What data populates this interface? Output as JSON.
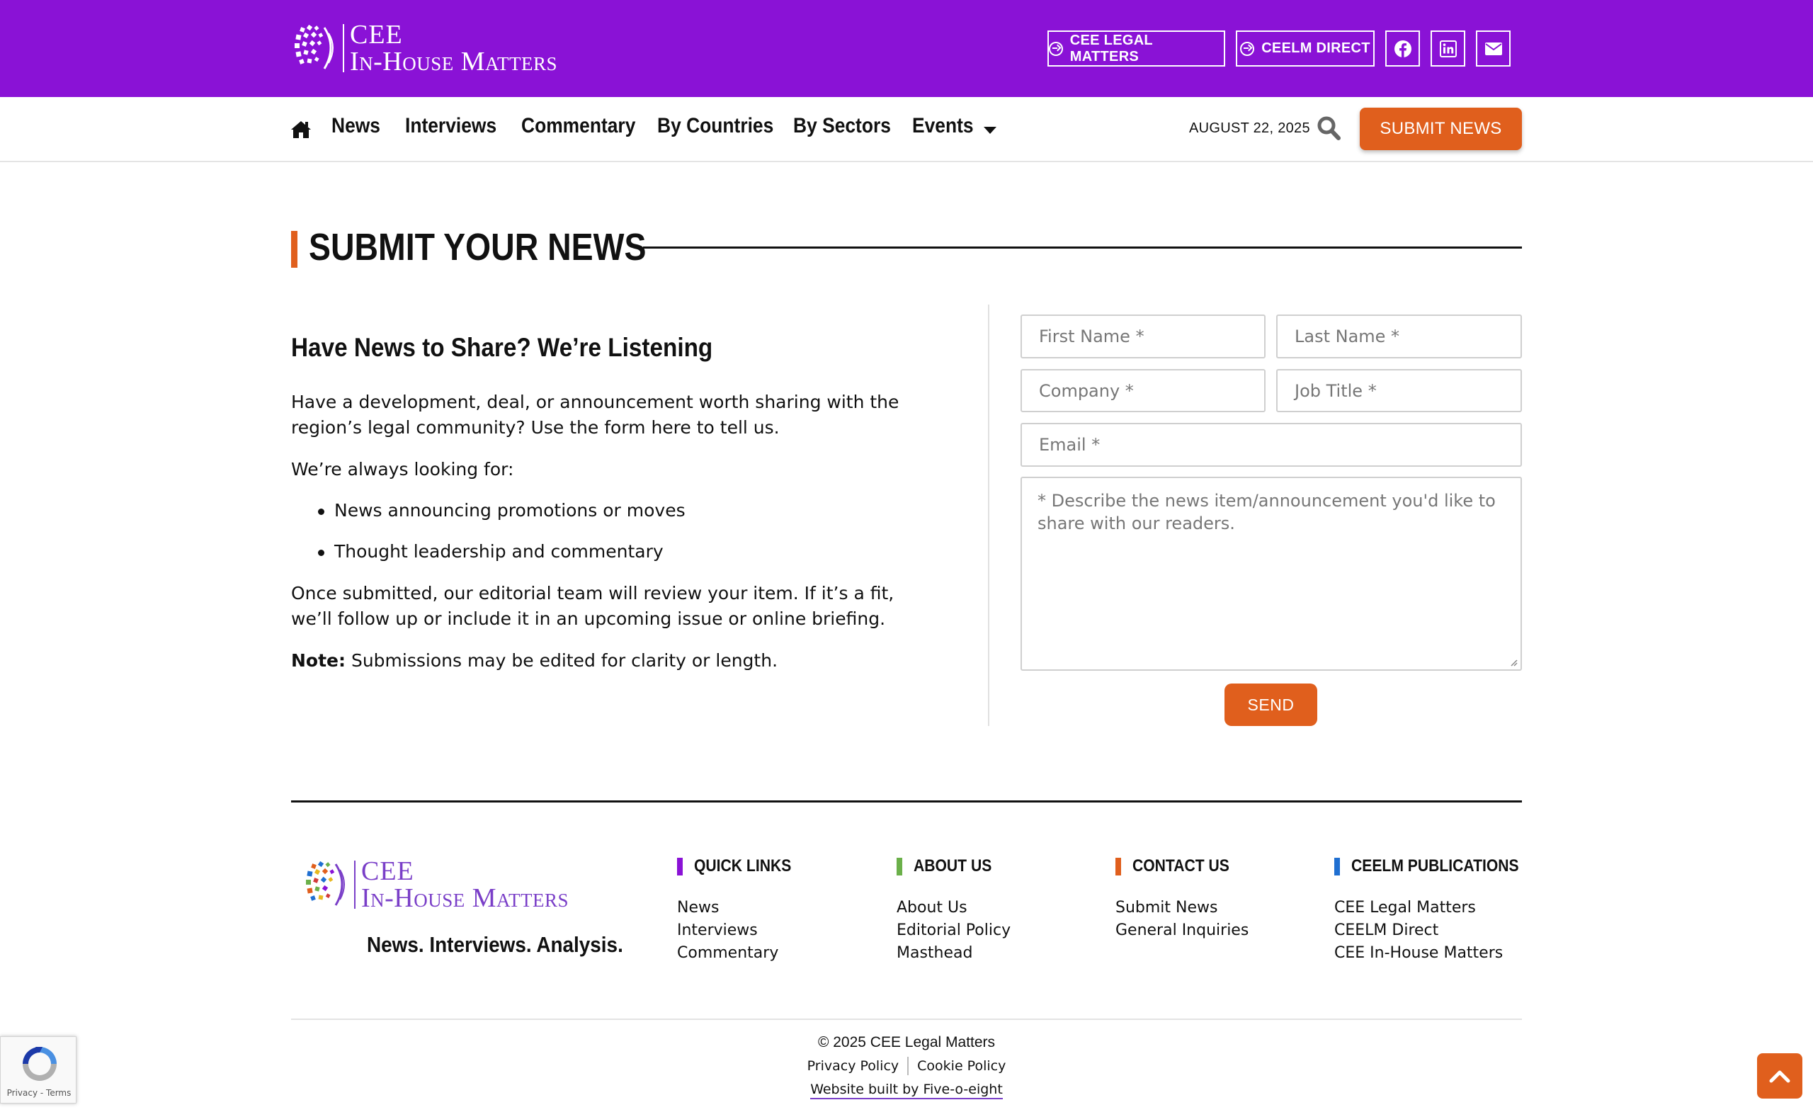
{
  "brand": {
    "line1": "CEE",
    "line2": "In-House Matters",
    "tagline": "News. Interviews. Analysis."
  },
  "topbar": {
    "buttons": [
      {
        "label": "CEE LEGAL MATTERS"
      },
      {
        "label": "CEELM DIRECT"
      }
    ],
    "social": [
      "facebook-icon",
      "linkedin-icon",
      "envelope-icon"
    ]
  },
  "nav": {
    "items": [
      {
        "label": "News"
      },
      {
        "label": "Interviews"
      },
      {
        "label": "Commentary"
      },
      {
        "label": "By Countries"
      },
      {
        "label": "By Sectors"
      },
      {
        "label": "Events"
      }
    ],
    "date": "AUGUST 22, 2025",
    "submit_label": "SUBMIT NEWS"
  },
  "page": {
    "title": "SUBMIT YOUR NEWS"
  },
  "content": {
    "heading": "Have News to Share? We’re Listening",
    "intro": "Have a development, deal, or announcement worth sharing with the region’s legal community? Use the form here to tell us.",
    "looking_for": "We’re always looking for:",
    "bullets": [
      "News announcing promotions or moves",
      "Thought leadership and commentary"
    ],
    "review": "Once submitted, our editorial team will review your item. If it’s a fit, we’ll follow up or include it in an upcoming issue or online briefing.",
    "note_label": "Note:",
    "note_text": " Submissions may be edited for clarity or length."
  },
  "form": {
    "first_name": {
      "placeholder": "First Name *",
      "value": ""
    },
    "last_name": {
      "placeholder": "Last Name *",
      "value": ""
    },
    "company": {
      "placeholder": "Company *",
      "value": ""
    },
    "job_title": {
      "placeholder": "Job Title *",
      "value": ""
    },
    "email": {
      "placeholder": "Email *",
      "value": ""
    },
    "message": {
      "placeholder": "* Describe the news item/announcement you'd like to share with our readers.",
      "value": ""
    },
    "send_label": "SEND"
  },
  "footer": {
    "columns": [
      {
        "title": "QUICK LINKS",
        "color": "#8a12d6",
        "links": [
          "News",
          "Interviews",
          "Commentary"
        ]
      },
      {
        "title": "ABOUT US",
        "color": "#6bb04a",
        "links": [
          "About Us",
          "Editorial Policy",
          "Masthead"
        ]
      },
      {
        "title": "CONTACT US",
        "color": "#e05f1d",
        "links": [
          "Submit News",
          "General Inquiries"
        ]
      },
      {
        "title": "CEELM PUBLICATIONS",
        "color": "#1f6fd1",
        "links": [
          "CEE Legal Matters",
          "CEELM Direct",
          "CEE In-House Matters"
        ]
      }
    ],
    "copyright": "© 2025 CEE Legal Matters",
    "legal": [
      "Privacy Policy",
      "Cookie Policy"
    ],
    "built_by": "Website built by Five-o-eight"
  },
  "recaptcha": {
    "label": "Privacy - Terms"
  },
  "colors": {
    "brand_purple": "#8a12d6",
    "accent_orange": "#e05f1d",
    "footer_logo_purple": "#7a3fc8"
  }
}
